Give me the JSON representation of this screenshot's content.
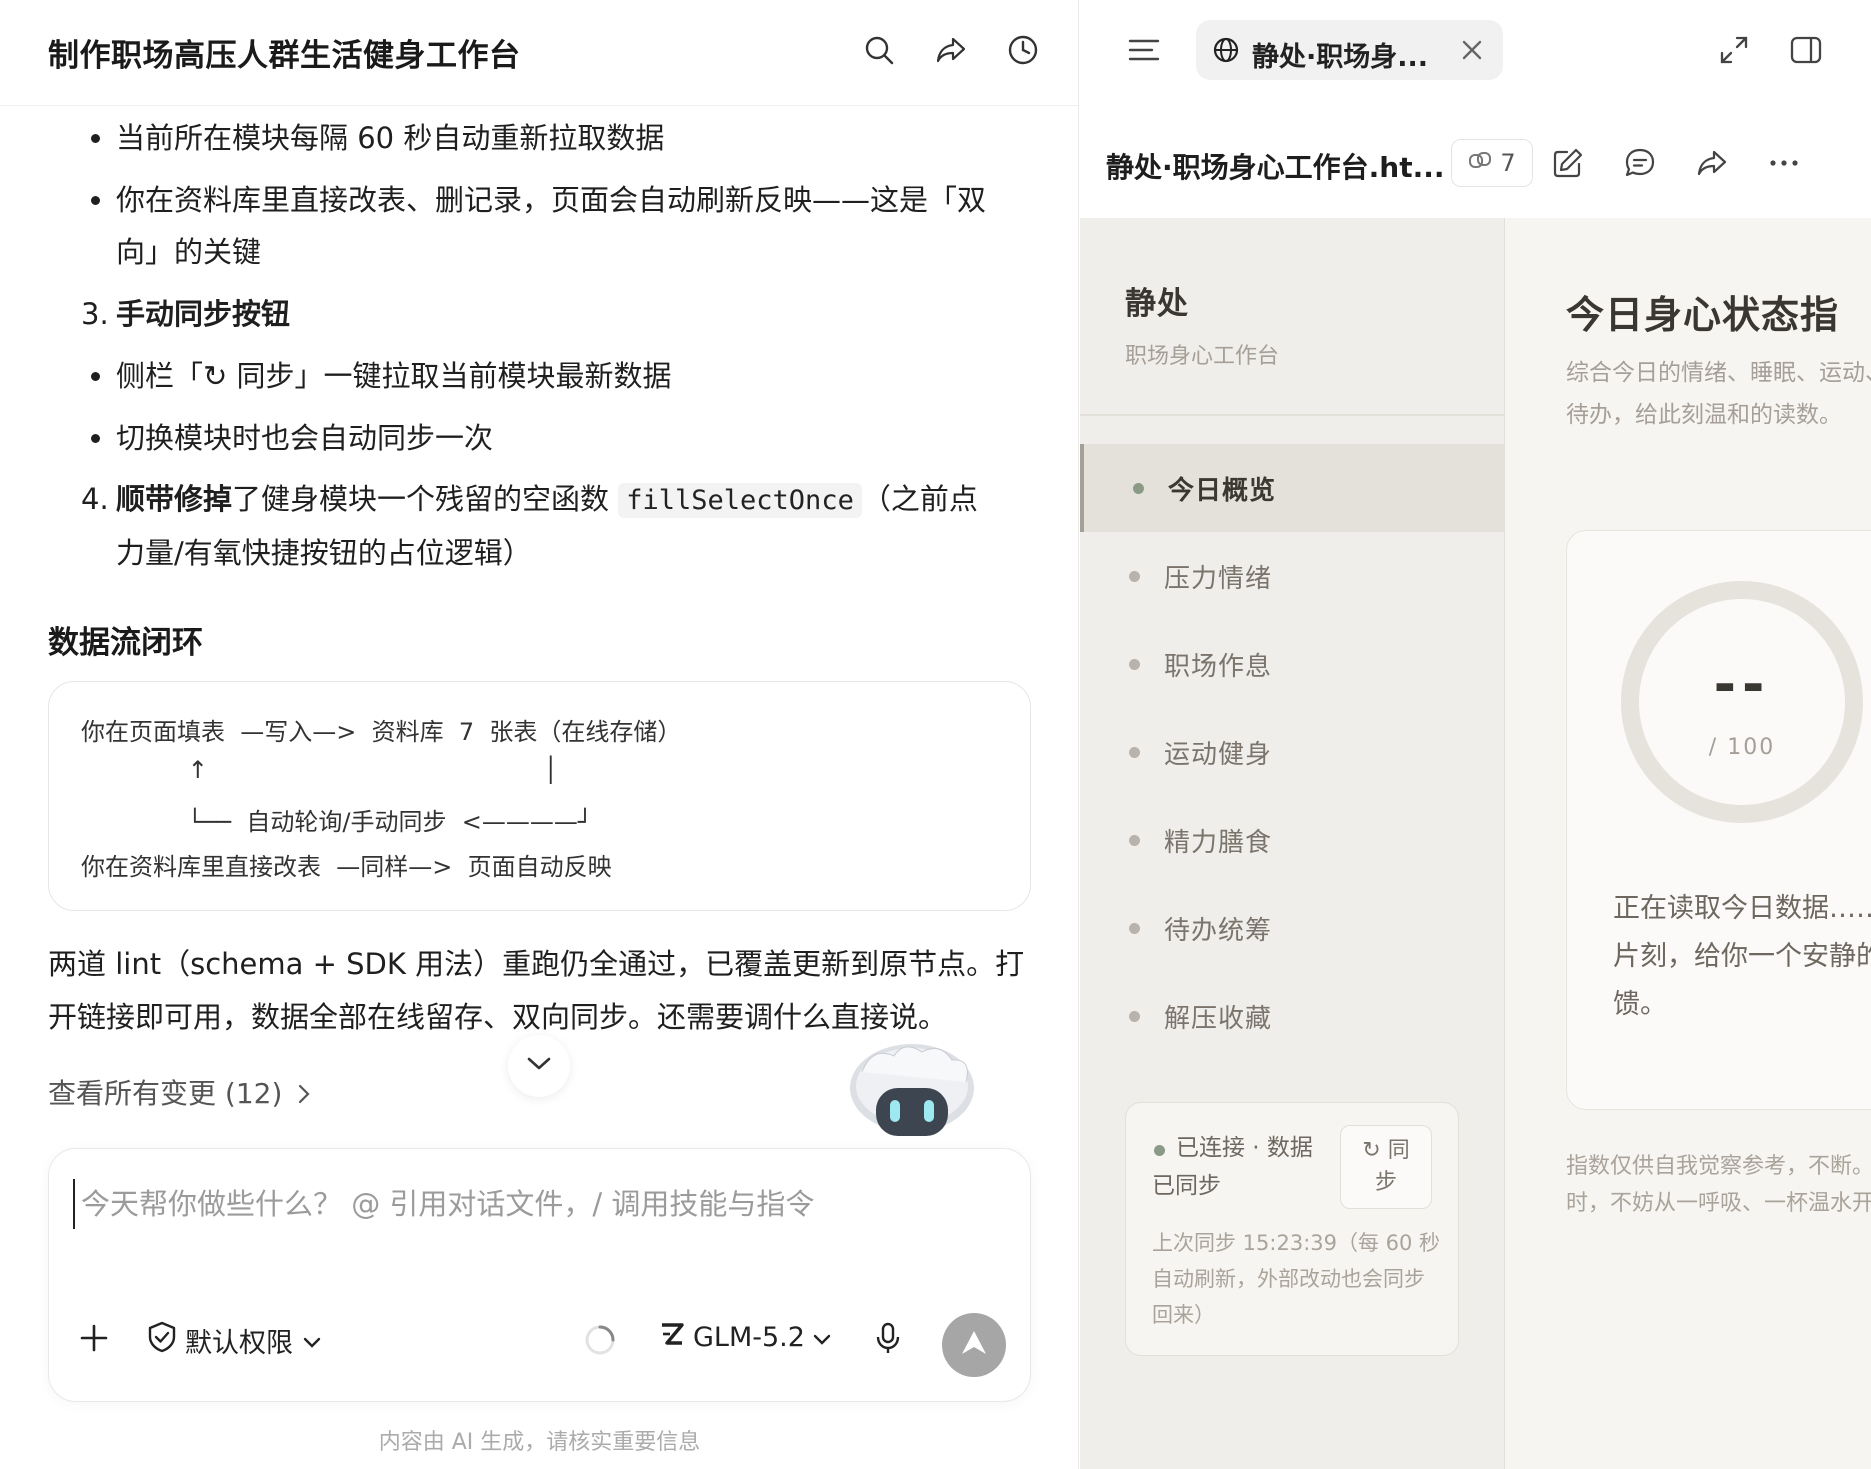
{
  "chat": {
    "title": "制作职场高压人群生活健身工作台",
    "bullets_top": [
      "当前所在模块每隔 60 秒自动重新拉取数据",
      "你在资料库里直接改表、删记录，页面会自动刷新反映——这是「双",
      "向」的关键"
    ],
    "item3_num": "3.",
    "item3_title": "手动同步按钮",
    "item3_bullets": [
      "侧栏「↻ 同步」一键拉取当前模块最新数据",
      "切换模块时也会自动同步一次"
    ],
    "item4_num": "4.",
    "item4_bold": "顺带修掉",
    "item4_text1": "了健身模块一个残留的空函数",
    "item4_code": "fillSelectOnce",
    "item4_text2": "（之前点",
    "item4_line2": "力量/有氧快捷按钮的占位逻辑）",
    "section_title": "数据流闭环",
    "flow_lines": [
      "你在页面填表  —写入—>  资料库  7  张表（在线存储）",
      "              ↑                                            │",
      "              └──  自动轮询/手动同步  <————┘",
      "你在资料库里直接改表  —同样—>  页面自动反映"
    ],
    "summary_line1": "两道 lint（schema + SDK 用法）重跑仍全通过，已覆盖更新到原节点。打",
    "summary_line2": "开链接即可用，数据全部在线留存、双向同步。还需要调什么直接说。",
    "changes_link": "查看所有变更 (12)",
    "input_placeholder": "今天帮你做些什么？ @ 引用对话文件，/ 调用技能与指令",
    "permission_label": "默认权限",
    "model_label": "GLM-5.2",
    "disclaimer": "内容由 AI 生成，请核实重要信息"
  },
  "preview": {
    "tab_label": "静处·职场身...",
    "file_name": "静处·职场身心工作台.ht...",
    "version_count": "7",
    "app": {
      "brand_name": "静处",
      "brand_sub": "职场身心工作台",
      "nav": [
        {
          "label": "今日概览",
          "active": true
        },
        {
          "label": "压力情绪",
          "active": false
        },
        {
          "label": "职场作息",
          "active": false
        },
        {
          "label": "运动健身",
          "active": false
        },
        {
          "label": "精力膳食",
          "active": false
        },
        {
          "label": "待办统筹",
          "active": false
        },
        {
          "label": "解压收藏",
          "active": false
        }
      ],
      "sync_status": "已连接 · 数据已同步",
      "sync_button": "↻ 同步",
      "sync_meta": "上次同步 15:23:39（每 60 秒自动刷新，外部改动也会同步回来）",
      "main_title": "今日身心状态指",
      "main_desc": "综合今日的情绪、睡眠、运动、饮食与待办，给此刻温和的读数。",
      "score_value": "--",
      "score_max": "/ 100",
      "reading_text": "正在读取今日数据……稍候片刻，给你一个安静的反馈。",
      "footnote": "指数仅供自我觉察参考，不断。状态偏低时，不妨从一呼吸、一杯温水开始。"
    }
  },
  "colors": {
    "accent_green": "#8a9a86",
    "sidebar_bg": "#f0eeea",
    "send_button": "#a6a6a6"
  }
}
